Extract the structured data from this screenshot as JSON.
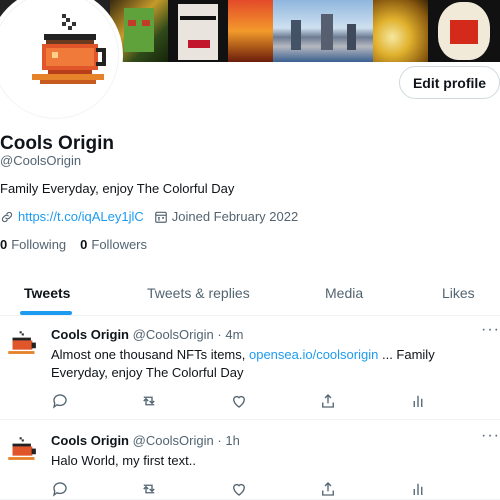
{
  "profile": {
    "name": "Cools Origin",
    "handle": "@CoolsOrigin",
    "bio": "Family Everyday, enjoy The Colorful Day",
    "link": "https://t.co/iqALey1jlC",
    "joined": "Joined February 2022",
    "following_count": "0",
    "following_label": "Following",
    "followers_count": "0",
    "followers_label": "Followers",
    "edit_button": "Edit profile"
  },
  "tabs": [
    {
      "label": "Tweets",
      "active": true
    },
    {
      "label": "Tweets & replies",
      "active": false
    },
    {
      "label": "Media",
      "active": false
    },
    {
      "label": "Likes",
      "active": false
    }
  ],
  "tweets": [
    {
      "name": "Cools Origin",
      "handle": "@CoolsOrigin",
      "sep": "·",
      "time": "4m",
      "text_before": "Almost one thousand NFTs items, ",
      "link": "opensea.io/coolsorigin",
      "text_after": " ... Family Everyday, enjoy The Colorful Day"
    },
    {
      "name": "Cools Origin",
      "handle": "@CoolsOrigin",
      "sep": "·",
      "time": "1h",
      "text_before": "Halo World, my first text..",
      "link": "",
      "text_after": ""
    }
  ],
  "icons": {
    "more": "more-icon",
    "reply": "reply-icon",
    "retweet": "retweet-icon",
    "like": "heart-icon",
    "share": "share-icon",
    "analytics": "analytics-icon"
  },
  "colors": {
    "accent": "#1d9bf0",
    "text": "#0f1419",
    "muted": "#536471"
  }
}
